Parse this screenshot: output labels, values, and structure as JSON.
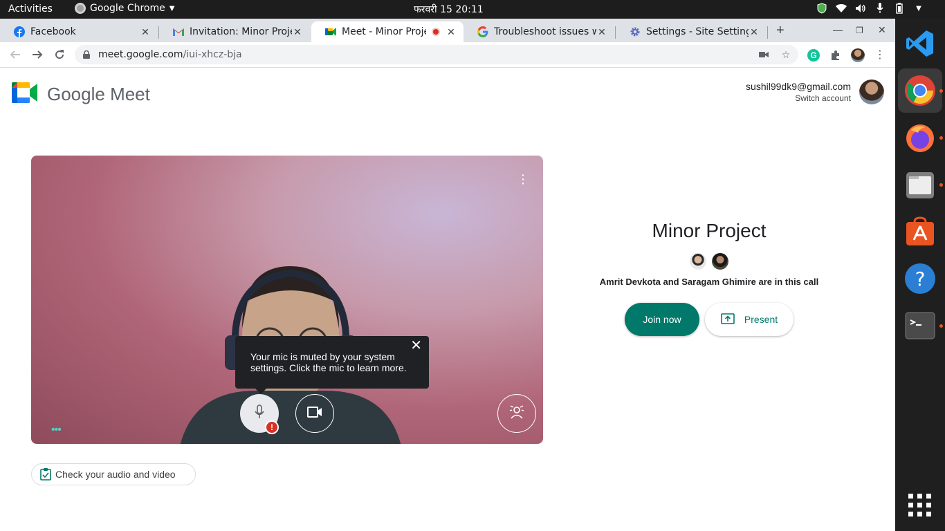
{
  "topbar": {
    "activities": "Activities",
    "app_name": "Google Chrome",
    "clock": "फरवरी 15  20:11"
  },
  "tabs": [
    {
      "title": "Facebook",
      "icon": "facebook-icon",
      "active": false
    },
    {
      "title": "Invitation: Minor Proje",
      "icon": "gmail-icon",
      "active": false
    },
    {
      "title": "Meet - Minor Projec",
      "icon": "meet-icon",
      "active": true
    },
    {
      "title": "Troubleshoot issues wi",
      "icon": "google-icon",
      "active": false
    },
    {
      "title": "Settings - Site Settings",
      "icon": "settings-gear-icon",
      "active": false
    }
  ],
  "address": {
    "host": "meet.google.com",
    "path": "/iui-xhcz-bja"
  },
  "meet": {
    "logo_text": "Google Meet",
    "account_email": "sushil99dk9@gmail.com",
    "switch_account": "Switch account",
    "tooltip": "Your mic is muted by your system settings. Click the mic to learn more.",
    "mic_badge": "!",
    "check_av": "Check your audio and video",
    "meeting_title": "Minor Project",
    "in_call_text": "Amrit Devkota and Saragam Ghimire are in this call",
    "join_label": "Join now",
    "present_label": "Present"
  },
  "colors": {
    "accent": "#00796b",
    "mic_error": "#d93025",
    "dock_bg": "#1f1f1f",
    "topbar_bg": "#1d1d1d"
  },
  "dock": [
    "vscode-icon",
    "chrome-icon",
    "firefox-icon",
    "files-icon",
    "software-icon",
    "help-icon",
    "terminal-icon",
    "app-grid-icon"
  ]
}
